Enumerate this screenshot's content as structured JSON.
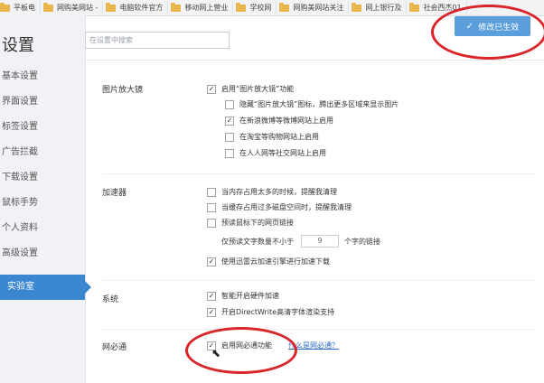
{
  "bookmarks": [
    "平板电",
    "网购美网站 -",
    "电脑软件官方",
    "移动网上营业",
    "学校网",
    "网购美网站关注",
    "网上银行及",
    "社会西杰01"
  ],
  "settings": {
    "title": "设置",
    "search_placeholder": "在设置中搜索",
    "saved_label": "修改已生效"
  },
  "nav": [
    "基本设置",
    "界面设置",
    "标签设置",
    "广告拦截",
    "下载设置",
    "鼠标手势",
    "个人资料",
    "高级设置",
    "实验室"
  ],
  "sections": {
    "magnifier": {
      "title": "图片放大镜",
      "main": "启用“图片放大镜”功能",
      "subs": [
        "隐藏“图片放大镜”图标，腾出更多区域来显示图片",
        "在新浪微博等微博网站上启用",
        "在淘宝等购物网站上启用",
        "在人人网等社交网站上启用"
      ]
    },
    "accelerator": {
      "title": "加速器",
      "opts": [
        "当内存占用太多的时候，提醒我清理",
        "当缓存占用过多磁盘空间时，提醒我清理",
        "预读鼠标下的网页链接"
      ],
      "prefetch_prefix": "仅预读文字数量不小于",
      "prefetch_value": "9",
      "prefetch_suffix": "个字的链接",
      "xunlei": "使用迅雷云加速引擎进行加速下载"
    },
    "system": {
      "title": "系统",
      "opts": [
        "智能开启硬件加速",
        "开启DirectWrite高清字体渲染支持"
      ]
    },
    "wangbitong": {
      "title": "网必通",
      "opt": "启用网必通功能",
      "link": "什么是网必通？"
    }
  }
}
